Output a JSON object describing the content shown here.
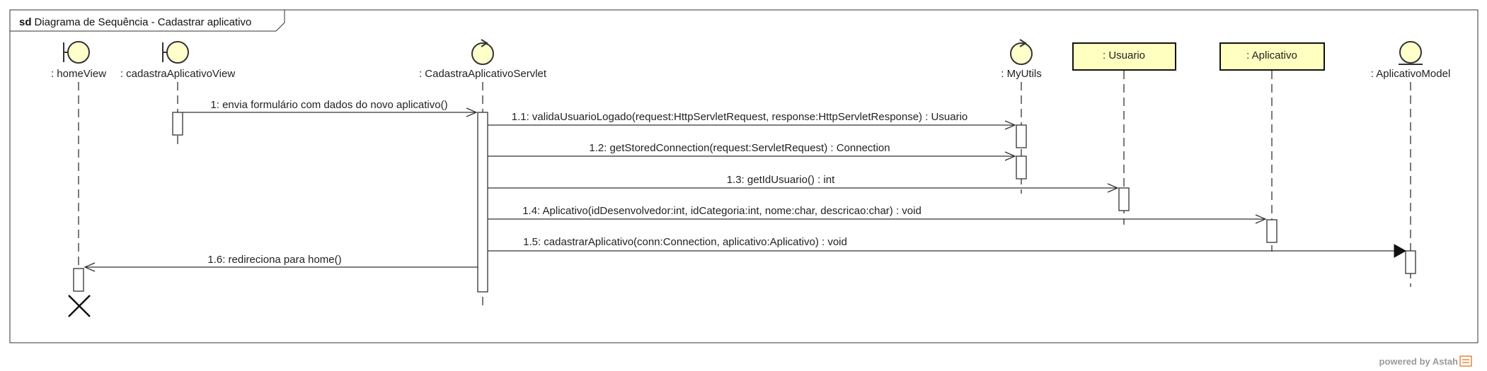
{
  "frame": {
    "keyword": "sd",
    "title": "Diagrama de Sequência - Cadastrar aplicativo"
  },
  "lifelines": [
    {
      "id": "homeView",
      "kind": "boundary",
      "label": ": homeView"
    },
    {
      "id": "cadastraAplicativoView",
      "kind": "boundary",
      "label": ": cadastraAplicativoView"
    },
    {
      "id": "servlet",
      "kind": "control",
      "label": ": CadastraAplicativoServlet"
    },
    {
      "id": "myUtils",
      "kind": "control",
      "label": ": MyUtils"
    },
    {
      "id": "usuario",
      "kind": "class-box",
      "label": ": Usuario"
    },
    {
      "id": "aplicativo",
      "kind": "class-box",
      "label": ": Aplicativo"
    },
    {
      "id": "aplicativoModel",
      "kind": "entity",
      "label": ": AplicativoModel"
    }
  ],
  "messages": [
    {
      "from": "cadastraAplicativoView",
      "to": "servlet",
      "label": "1: envia formulário com dados do novo aplicativo()"
    },
    {
      "from": "servlet",
      "to": "myUtils",
      "label": "1.1: validaUsuarioLogado(request:HttpServletRequest, response:HttpServletResponse) : Usuario"
    },
    {
      "from": "servlet",
      "to": "myUtils",
      "label": "1.2: getStoredConnection(request:ServletRequest) : Connection"
    },
    {
      "from": "servlet",
      "to": "usuario",
      "label": "1.3: getIdUsuario() : int"
    },
    {
      "from": "servlet",
      "to": "aplicativo",
      "label": "1.4: Aplicativo(idDesenvolvedor:int, idCategoria:int, nome:char, descricao:char) : void"
    },
    {
      "from": "servlet",
      "to": "aplicativoModel",
      "label": "1.5: cadastrarAplicativo(conn:Connection, aplicativo:Aplicativo) : void"
    },
    {
      "from": "servlet",
      "to": "homeView",
      "label": "1.6: redireciona para home()"
    }
  ],
  "footer": {
    "text": "powered by Astah"
  },
  "colors": {
    "stroke": "#333333",
    "icon_fill": "#ffffcc",
    "box_fill": "#ffffc0",
    "footer_logo": "#e8883a"
  }
}
